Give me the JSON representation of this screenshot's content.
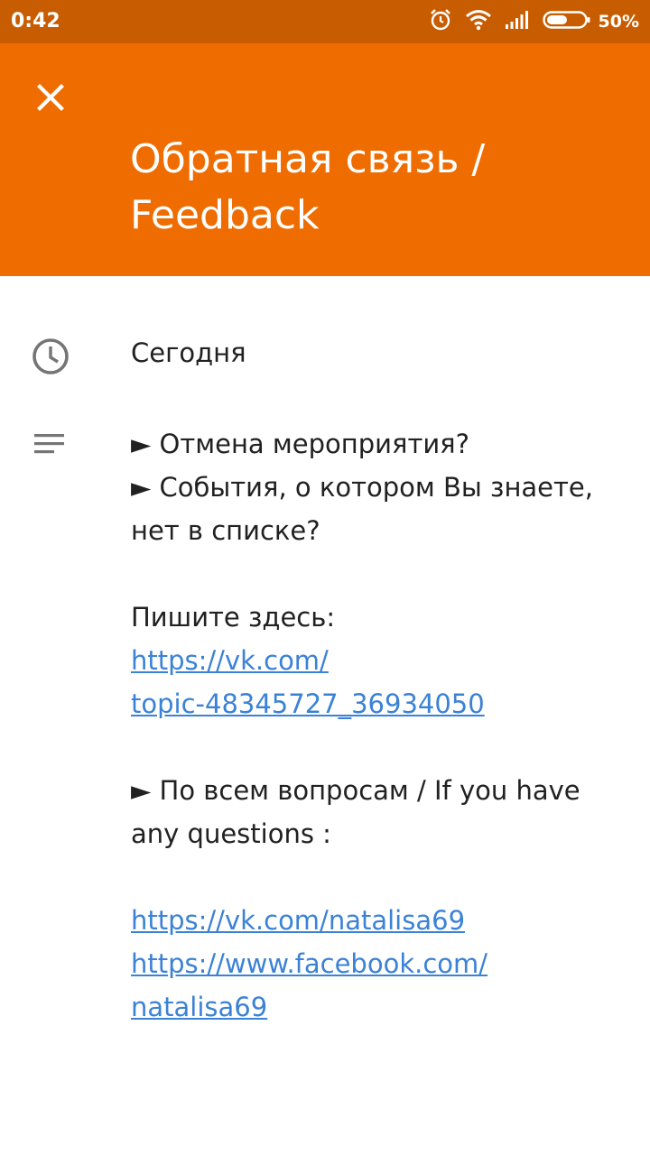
{
  "status_bar": {
    "time": "0:42",
    "battery_text": "50%",
    "icons": [
      "alarm-icon",
      "wifi-icon",
      "signal-icon",
      "battery-icon"
    ]
  },
  "header": {
    "close_icon": "close-icon",
    "title_line1": "Обратная связь /",
    "title_line2": "Feedback",
    "background_color": "#ef6c00"
  },
  "event": {
    "time_icon": "clock-icon",
    "date": "Сегодня",
    "description_icon": "notes-icon",
    "lines": {
      "l1": "► Отмена мероприятия?",
      "l2": "► События, о котором Вы знаете,",
      "l3": "нет в списке?",
      "l4": "Пишите здесь:",
      "l7": "► По всем вопросам / If you have",
      "l8": "any questions :"
    },
    "links": {
      "vk_topic_line1": "https://vk.com/",
      "vk_topic_line2": "topic-48345727_36934050",
      "vk_profile": "https://vk.com/natalisa69",
      "facebook_line1": "https://www.facebook.com/",
      "facebook_line2": "natalisa69"
    },
    "link_color": "#3b82d6"
  }
}
